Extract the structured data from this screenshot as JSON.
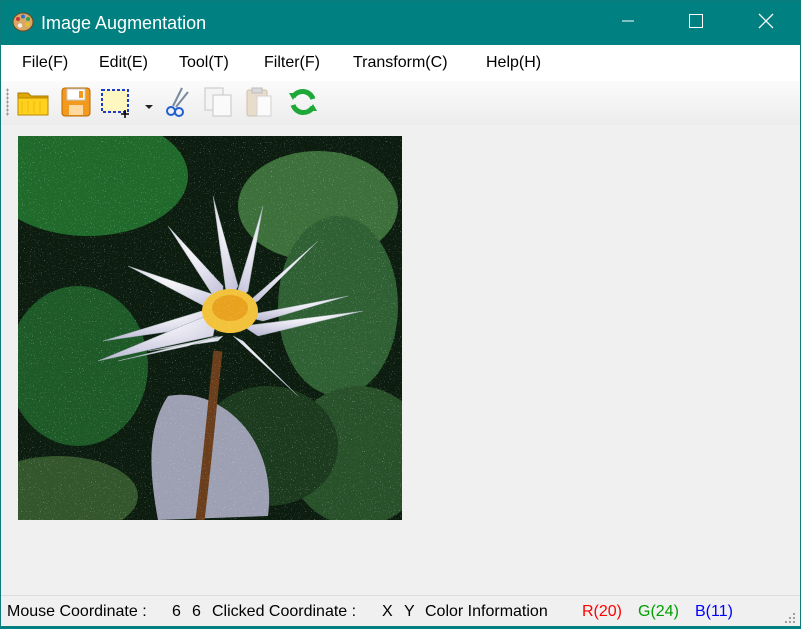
{
  "window": {
    "title": "Image Augmentation",
    "title_bar_color": "#008080",
    "app_icon": "palette-icon",
    "controls": [
      "minimize-icon",
      "maximize-icon",
      "close-icon"
    ]
  },
  "menu": {
    "items": [
      {
        "label": "File(F)"
      },
      {
        "label": "Edit(E)"
      },
      {
        "label": "Tool(T)"
      },
      {
        "label": "Filter(F)"
      },
      {
        "label": "Transform(C)"
      },
      {
        "label": "Help(H)"
      }
    ]
  },
  "toolbar": {
    "buttons": [
      {
        "icon": "open-folder-icon"
      },
      {
        "icon": "save-icon"
      },
      {
        "icon": "select-region-icon",
        "has_dropdown": true
      },
      {
        "icon": "scissors-icon"
      },
      {
        "icon": "copy-icon",
        "disabled": true
      },
      {
        "icon": "paste-icon",
        "disabled": true
      },
      {
        "icon": "refresh-icon"
      }
    ]
  },
  "canvas": {
    "image": "water-lily-photo-with-salt-and-pepper-noise"
  },
  "status": {
    "mouse_label": "Mouse Coordinate :",
    "mouse_x": "6",
    "mouse_y": "6",
    "clicked_label": "Clicked Coordinate :",
    "clicked_x": "X",
    "clicked_y": "Y",
    "color_label": "Color Information",
    "r": "R(20)",
    "g": "G(24)",
    "b": "B(11)",
    "r_color": "#ff0000",
    "g_color": "#00a000",
    "b_color": "#0000ff"
  }
}
